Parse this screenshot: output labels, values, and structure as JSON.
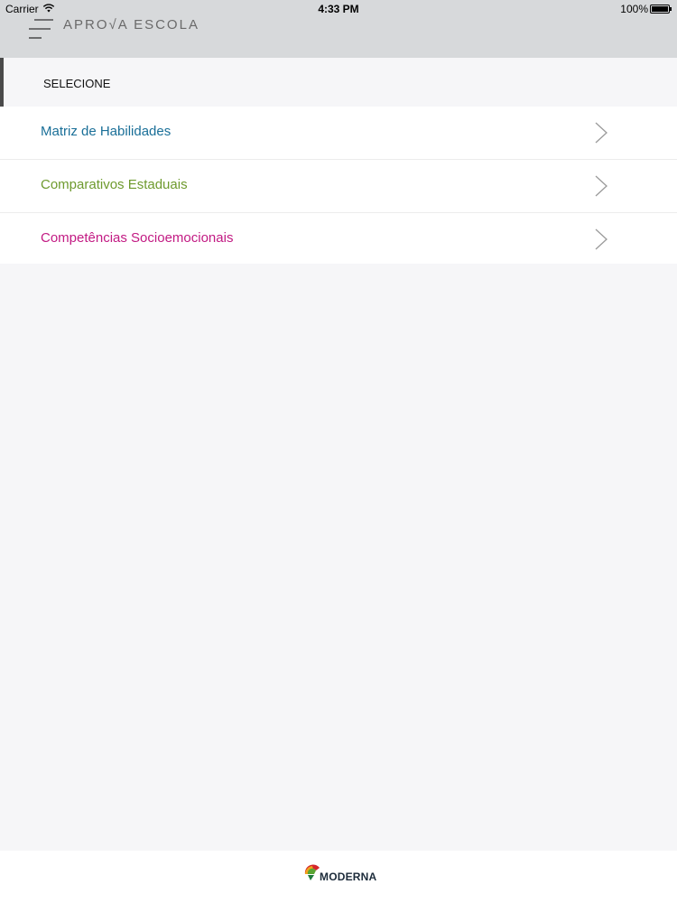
{
  "status_bar": {
    "carrier": "Carrier",
    "time": "4:33 PM",
    "battery": "100%"
  },
  "header": {
    "menu_icon": "hamburger-menu-icon",
    "brand": "APRO√A ESCOLA"
  },
  "section": {
    "title": "SELECIONE",
    "accent_color": "#4a4a4a"
  },
  "list": {
    "items": [
      {
        "label": "Matriz de Habilidades",
        "color": "#1a6f98",
        "icon": "chevron-right-icon"
      },
      {
        "label": "Comparativos Estaduais",
        "color": "#6e9a2e",
        "icon": "chevron-right-icon"
      },
      {
        "label": "Competências Socioemocionais",
        "color": "#c21a83",
        "icon": "chevron-right-icon"
      }
    ]
  },
  "footer": {
    "logo_text": "MODERNA"
  }
}
